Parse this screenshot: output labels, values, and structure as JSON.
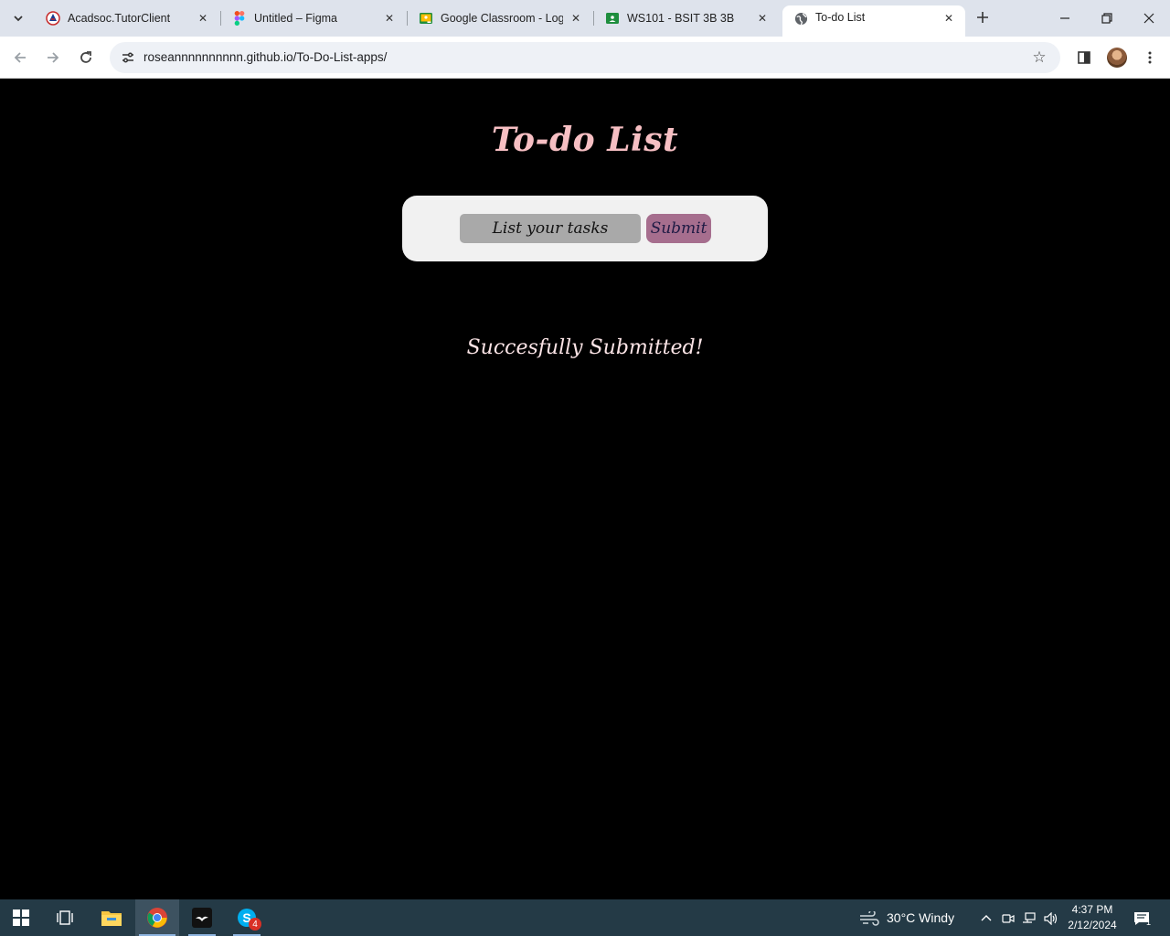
{
  "browser": {
    "tabs": [
      {
        "title": "Acadsoc.TutorClient",
        "icon": "acadsoc-favicon"
      },
      {
        "title": "Untitled – Figma",
        "icon": "figma-favicon"
      },
      {
        "title": "Google Classroom - Login",
        "icon": "google-classroom-favicon"
      },
      {
        "title": "WS101 - BSIT 3B 3B",
        "icon": "google-classroom-favicon"
      },
      {
        "title": "To-do List",
        "icon": "globe-favicon"
      }
    ],
    "active_tab": 4,
    "url": "roseannnnnnnnnn.github.io/To-Do-List-apps/"
  },
  "page": {
    "title": "To-do List",
    "input_placeholder": "List your tasks",
    "submit_label": "Submit",
    "status_message": "Succesfully Submitted!"
  },
  "taskbar": {
    "weather": "30°C  Windy",
    "time": "4:37 PM",
    "date": "2/12/2024",
    "skype_badge": "4",
    "notification_count": "1"
  },
  "colors": {
    "title": "#f7bfc3",
    "card": "#f1f1f1",
    "input": "#a9a9a9",
    "submit": "#a66e8e",
    "status": "#fbe4e6",
    "taskbar": "#243a46"
  }
}
